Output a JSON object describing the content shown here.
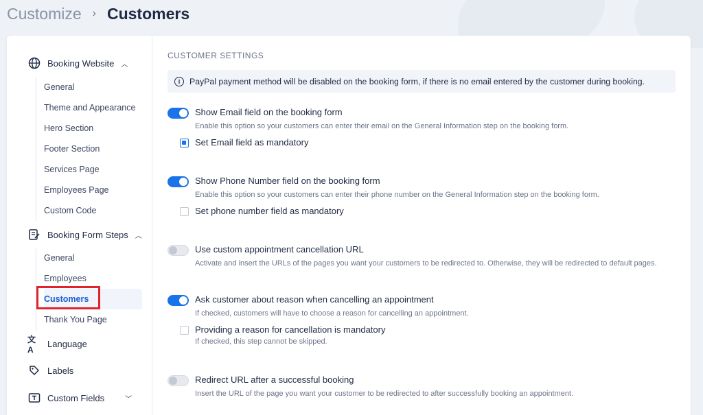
{
  "breadcrumb": {
    "root": "Customize",
    "separator": "›",
    "current": "Customers"
  },
  "sidebar": {
    "booking_website": {
      "label": "Booking Website",
      "icon": "globe-icon",
      "items": [
        "General",
        "Theme and Appearance",
        "Hero Section",
        "Footer Section",
        "Services Page",
        "Employees Page",
        "Custom Code"
      ]
    },
    "booking_form_steps": {
      "label": "Booking Form Steps",
      "icon": "form-edit-icon",
      "items": [
        "General",
        "Employees",
        "Customers",
        "Thank You Page"
      ],
      "active": "Customers"
    },
    "language": {
      "label": "Language",
      "icon": "translate-icon"
    },
    "labels": {
      "label": "Labels",
      "icon": "tag-icon"
    },
    "custom_fields": {
      "label": "Custom Fields",
      "icon": "text-field-icon"
    }
  },
  "content": {
    "section_title": "CUSTOMER SETTINGS",
    "notice": "PayPal payment method will be disabled on the booking form, if there is no email entered by the customer during booking.",
    "email": {
      "label": "Show Email field on the booking form",
      "desc": "Enable this option so your customers can enter their email on the General Information step on the booking form.",
      "enabled": true,
      "mandatory_label": "Set Email field as mandatory",
      "mandatory": true
    },
    "phone": {
      "label": "Show Phone Number field on the booking form",
      "desc": "Enable this option so your customers can enter their phone number on the General Information step on the booking form.",
      "enabled": true,
      "mandatory_label": "Set phone number field as mandatory",
      "mandatory": false
    },
    "cancel_url": {
      "label": "Use custom appointment cancellation URL",
      "desc": "Activate and insert the URLs of the pages you want your customers to be redirected to. Otherwise, they will be redirected to default pages.",
      "enabled": false
    },
    "cancel_reason": {
      "label": "Ask customer about reason when cancelling an appointment",
      "desc": "If checked, customers will have to choose a reason for cancelling an appointment.",
      "enabled": true,
      "mandatory_label": "Providing a reason for cancellation is mandatory",
      "mandatory_desc": "If checked, this step cannot be skipped.",
      "mandatory": false
    },
    "redirect": {
      "label": "Redirect URL after a successful booking",
      "desc": "Insert the URL of the page you want your customer to be redirected to after successfully booking an appointment.",
      "enabled": false
    }
  },
  "colors": {
    "accent": "#1a73e8",
    "highlight_box": "#e0242b"
  }
}
